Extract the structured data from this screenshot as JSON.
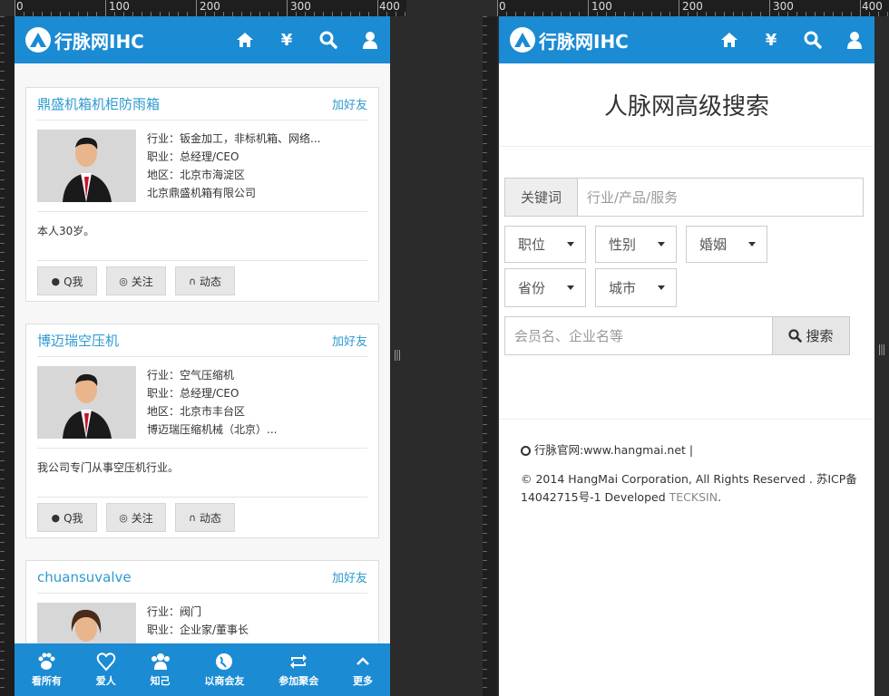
{
  "ruler": {
    "labels": [
      "0",
      "100",
      "200",
      "300",
      "400"
    ]
  },
  "app": {
    "logo_text": "行脉网IHC"
  },
  "left": {
    "cards": [
      {
        "title": "鼎盛机箱机柜防雨箱",
        "add": "加好友",
        "industry": "行业：钣金加工，非标机箱、网络...",
        "job": "职业：总经理/CEO",
        "region": "地区：北京市海淀区",
        "company": "北京鼎盛机箱有限公司",
        "desc": "本人30岁。"
      },
      {
        "title": "博迈瑞空压机",
        "add": "加好友",
        "industry": "行业：空气压缩机",
        "job": "职业：总经理/CEO",
        "region": "地区：北京市丰台区",
        "company": "博迈瑞压缩机械（北京）...",
        "desc": "我公司专门从事空压机行业。"
      },
      {
        "title": "chuansuvalve",
        "add": "加好友",
        "industry": "行业：阀门",
        "job": "职业：企业家/董事长",
        "region": "",
        "company": "",
        "desc": ""
      }
    ],
    "actions": [
      "Q我",
      "关注",
      "动态"
    ],
    "bottom_nav": [
      "看所有",
      "爱人",
      "知己",
      "以商会友",
      "参加聚会",
      "更多"
    ]
  },
  "right": {
    "title": "人脉网高级搜索",
    "keyword_label": "关键词",
    "keyword_placeholder": "行业/产品/服务",
    "selects_row1": [
      "职位",
      "性别",
      "婚姻"
    ],
    "selects_row2": [
      "省份",
      "城市"
    ],
    "member_placeholder": "会员名、企业名等",
    "search_btn": "搜索",
    "footer_site": "行脉官网:www.hangmai.net |",
    "footer_copy1": "© 2014 HangMai Corporation, All Rights Reserved . 苏ICP备",
    "footer_copy2": "14042715号-1 Developed ",
    "footer_dev": "TECKSIN",
    "footer_dot": "."
  },
  "colors": {
    "brand": "#1b8bd3",
    "link": "#2e9ad0"
  }
}
